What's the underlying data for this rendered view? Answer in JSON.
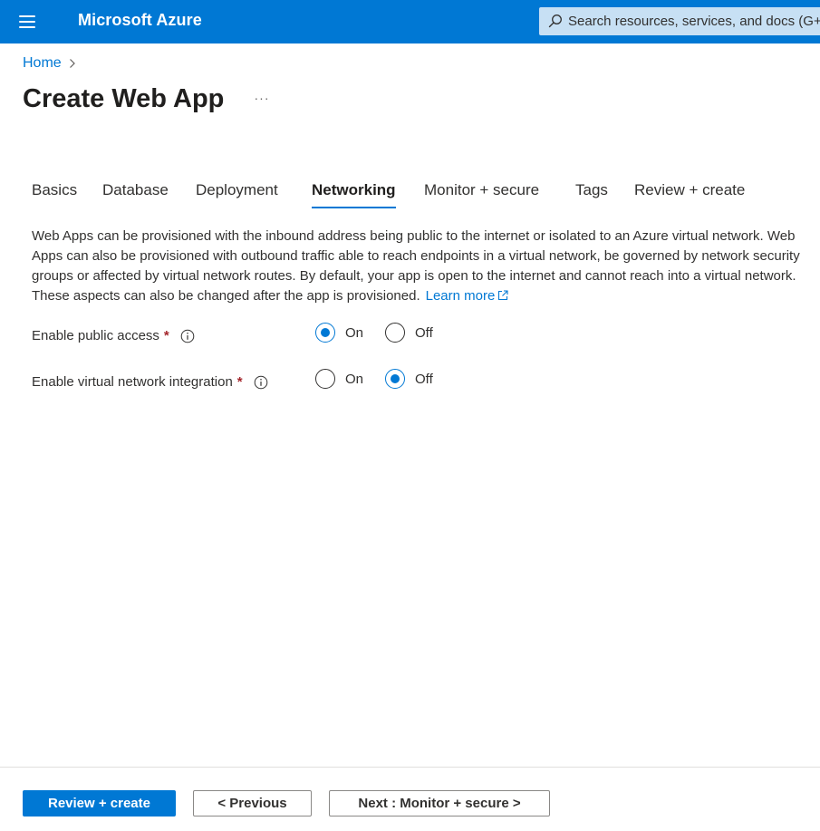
{
  "header": {
    "brand": "Microsoft Azure",
    "search_placeholder": "Search resources, services, and docs (G+/)"
  },
  "breadcrumb": {
    "home": "Home"
  },
  "page": {
    "title": "Create Web App",
    "more": "···"
  },
  "tabs": [
    {
      "label": "Basics"
    },
    {
      "label": "Database"
    },
    {
      "label": "Deployment"
    },
    {
      "label": "Networking",
      "active": true
    },
    {
      "label": "Monitor + secure"
    },
    {
      "label": "Tags"
    },
    {
      "label": "Review + create"
    }
  ],
  "description": {
    "text": "Web Apps can be provisioned with the inbound address being public to the internet or isolated to an Azure virtual network. Web Apps can also be provisioned with outbound traffic able to reach endpoints in a virtual network, be governed by network security groups or affected by virtual network routes. By default, your app is open to the internet and cannot reach into a virtual network. These aspects can also be changed after the app is provisioned.",
    "link": "Learn more"
  },
  "fields": {
    "public_access": {
      "label": "Enable public access",
      "required": "*",
      "on": "On",
      "off": "Off",
      "selected": "On"
    },
    "vnet_integration": {
      "label": "Enable virtual network integration",
      "required": "*",
      "on": "On",
      "off": "Off",
      "selected": "Off"
    }
  },
  "footer": {
    "review_create": "Review + create",
    "previous": "< Previous",
    "next": "Next : Monitor + secure >"
  },
  "colors": {
    "accent": "#0078d4",
    "required": "#a4262c",
    "search_bg": "#c7e0f4"
  }
}
